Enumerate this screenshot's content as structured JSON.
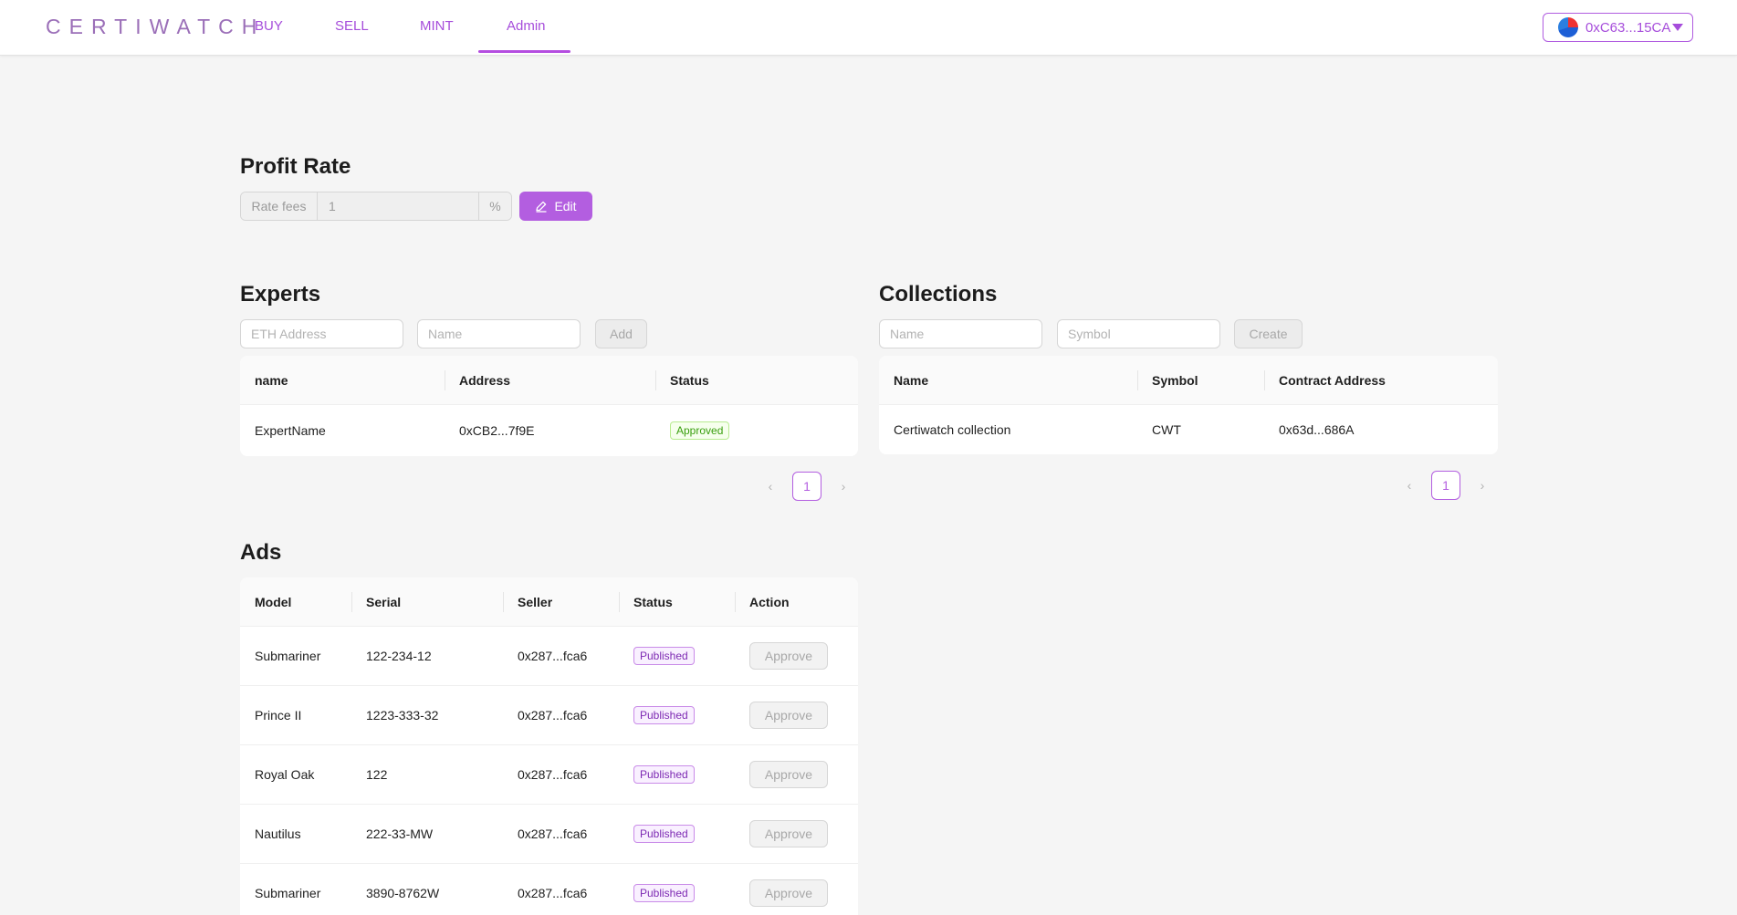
{
  "header": {
    "logo": "CERTIWATCH",
    "nav": [
      {
        "label": "BUY"
      },
      {
        "label": "SELL"
      },
      {
        "label": "MINT"
      },
      {
        "label": "Admin",
        "active": true
      }
    ],
    "wallet_address": "0xC63...15CA"
  },
  "profit_rate": {
    "title": "Profit Rate",
    "addon_before": "Rate fees",
    "value": "1",
    "addon_after": "%",
    "edit_label": "Edit"
  },
  "experts": {
    "title": "Experts",
    "address_placeholder": "ETH Address",
    "name_placeholder": "Name",
    "add_label": "Add",
    "columns": [
      "name",
      "Address",
      "Status"
    ],
    "rows": [
      {
        "name": "ExpertName",
        "address": "0xCB2...7f9E",
        "status": "Approved"
      }
    ],
    "page": "1"
  },
  "collections": {
    "title": "Collections",
    "name_placeholder": "Name",
    "symbol_placeholder": "Symbol",
    "create_label": "Create",
    "columns": [
      "Name",
      "Symbol",
      "Contract Address"
    ],
    "rows": [
      {
        "name": "Certiwatch collection",
        "symbol": "CWT",
        "contract": "0x63d...686A"
      }
    ],
    "page": "1"
  },
  "ads": {
    "title": "Ads",
    "columns": [
      "Model",
      "Serial",
      "Seller",
      "Status",
      "Action"
    ],
    "approve_label": "Approve",
    "rows": [
      {
        "model": "Submariner",
        "serial": "122-234-12",
        "seller": "0x287...fca6",
        "status": "Published"
      },
      {
        "model": "Prince II",
        "serial": "1223-333-32",
        "seller": "0x287...fca6",
        "status": "Published"
      },
      {
        "model": "Royal Oak",
        "serial": "122",
        "seller": "0x287...fca6",
        "status": "Published"
      },
      {
        "model": "Nautilus",
        "serial": "222-33-MW",
        "seller": "0x287...fca6",
        "status": "Published"
      },
      {
        "model": "Submariner",
        "serial": "3890-8762W",
        "seller": "0x287...fca6",
        "status": "Published"
      }
    ]
  },
  "colors": {
    "accent": "#b35ee0",
    "approved": "#389e0d",
    "published": "#7d2ab3"
  }
}
